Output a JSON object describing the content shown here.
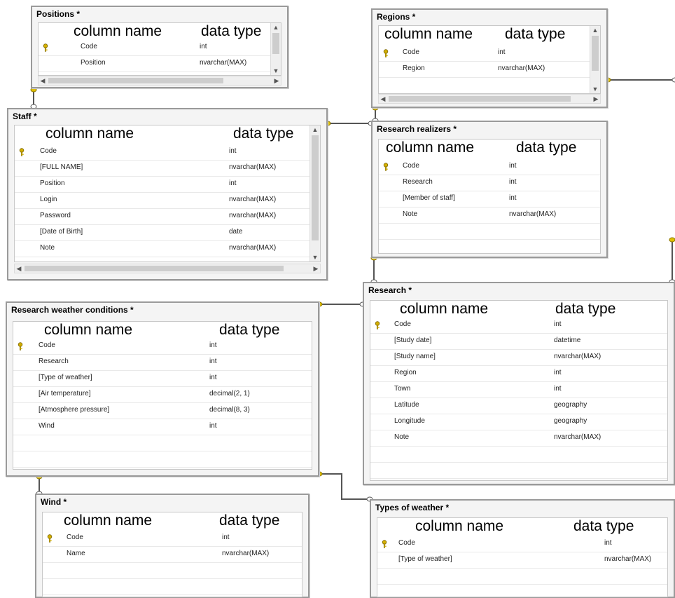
{
  "column_header": {
    "name": "column name",
    "type": "data type"
  },
  "tables": [
    {
      "id": "positions",
      "title": "Positions *",
      "scrollbars": {
        "vertical": true,
        "horizontal": true
      },
      "columns": [
        {
          "name": "Code",
          "type": "int",
          "key": true
        },
        {
          "name": "Position",
          "type": "nvarchar(MAX)",
          "key": false
        }
      ]
    },
    {
      "id": "regions",
      "title": "Regions *",
      "scrollbars": {
        "vertical": true,
        "horizontal": true
      },
      "columns": [
        {
          "name": "Code",
          "type": "int",
          "key": true
        },
        {
          "name": "Region",
          "type": "nvarchar(MAX)",
          "key": false
        }
      ]
    },
    {
      "id": "staff",
      "title": "Staff *",
      "scrollbars": {
        "vertical": true,
        "horizontal": true
      },
      "columns": [
        {
          "name": "Code",
          "type": "int",
          "key": true
        },
        {
          "name": "[FULL NAME]",
          "type": "nvarchar(MAX)",
          "key": false
        },
        {
          "name": "Position",
          "type": "int",
          "key": false
        },
        {
          "name": "Login",
          "type": "nvarchar(MAX)",
          "key": false
        },
        {
          "name": "Password",
          "type": "nvarchar(MAX)",
          "key": false
        },
        {
          "name": "[Date of Birth]",
          "type": "date",
          "key": false
        },
        {
          "name": "Note",
          "type": "nvarchar(MAX)",
          "key": false
        }
      ]
    },
    {
      "id": "research_realizers",
      "title": "Research realizers *",
      "scrollbars": {
        "vertical": false,
        "horizontal": false
      },
      "columns": [
        {
          "name": "Code",
          "type": "int",
          "key": true
        },
        {
          "name": "Research",
          "type": "int",
          "key": false
        },
        {
          "name": "[Member of staff]",
          "type": "int",
          "key": false
        },
        {
          "name": "Note",
          "type": "nvarchar(MAX)",
          "key": false
        }
      ]
    },
    {
      "id": "research_weather_conditions",
      "title": "Research weather conditions *",
      "scrollbars": {
        "vertical": false,
        "horizontal": false
      },
      "columns": [
        {
          "name": "Code",
          "type": "int",
          "key": true
        },
        {
          "name": "Research",
          "type": "int",
          "key": false
        },
        {
          "name": "[Type of weather]",
          "type": "int",
          "key": false
        },
        {
          "name": "[Air temperature]",
          "type": "decimal(2, 1)",
          "key": false
        },
        {
          "name": "[Atmosphere pressure]",
          "type": "decimal(8, 3)",
          "key": false
        },
        {
          "name": "Wind",
          "type": "int",
          "key": false
        }
      ]
    },
    {
      "id": "research",
      "title": "Research *",
      "scrollbars": {
        "vertical": false,
        "horizontal": false
      },
      "columns": [
        {
          "name": "Code",
          "type": "int",
          "key": true
        },
        {
          "name": "[Study date]",
          "type": "datetime",
          "key": false
        },
        {
          "name": "[Study name]",
          "type": "nvarchar(MAX)",
          "key": false
        },
        {
          "name": "Region",
          "type": "int",
          "key": false
        },
        {
          "name": "Town",
          "type": "int",
          "key": false
        },
        {
          "name": "Latitude",
          "type": "geography",
          "key": false
        },
        {
          "name": "Longitude",
          "type": "geography",
          "key": false
        },
        {
          "name": "Note",
          "type": "nvarchar(MAX)",
          "key": false
        }
      ]
    },
    {
      "id": "wind",
      "title": "Wind *",
      "scrollbars": {
        "vertical": false,
        "horizontal": false
      },
      "columns": [
        {
          "name": "Code",
          "type": "int",
          "key": true
        },
        {
          "name": "Name",
          "type": "nvarchar(MAX)",
          "key": false
        }
      ]
    },
    {
      "id": "types_of_weather",
      "title": "Types of weather *",
      "scrollbars": {
        "vertical": false,
        "horizontal": false
      },
      "columns": [
        {
          "name": "Code",
          "type": "int",
          "key": true
        },
        {
          "name": "[Type of weather]",
          "type": "nvarchar(MAX)",
          "key": false
        }
      ]
    }
  ],
  "relationships": [
    {
      "from": "positions",
      "to": "staff"
    },
    {
      "from": "staff",
      "to": "research_realizers"
    },
    {
      "from": "regions",
      "to": "research_realizers"
    },
    {
      "from": "research_realizers",
      "to": "research"
    },
    {
      "from": "research_weather_conditions",
      "to": "research"
    },
    {
      "from": "research_weather_conditions",
      "to": "wind"
    },
    {
      "from": "research_weather_conditions",
      "to": "types_of_weather"
    },
    {
      "from": "regions",
      "to": "research"
    }
  ],
  "colors": {
    "key_icon": "#d4b000",
    "connector": "#555555",
    "connector_endpoint": "#e0c000"
  }
}
